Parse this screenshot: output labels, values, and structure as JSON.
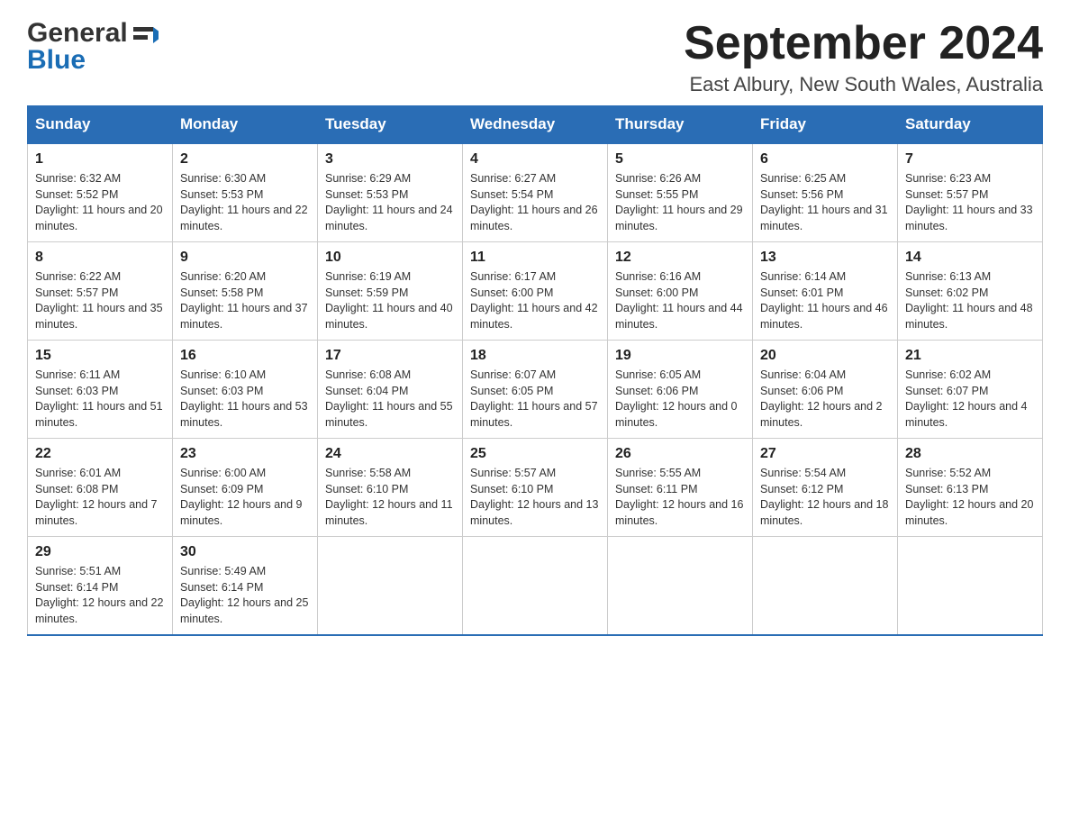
{
  "header": {
    "logo_general": "General",
    "logo_blue": "Blue",
    "month_title": "September 2024",
    "location": "East Albury, New South Wales, Australia"
  },
  "weekdays": [
    "Sunday",
    "Monday",
    "Tuesday",
    "Wednesday",
    "Thursday",
    "Friday",
    "Saturday"
  ],
  "weeks": [
    [
      {
        "day": "1",
        "sunrise": "6:32 AM",
        "sunset": "5:52 PM",
        "daylight": "11 hours and 20 minutes."
      },
      {
        "day": "2",
        "sunrise": "6:30 AM",
        "sunset": "5:53 PM",
        "daylight": "11 hours and 22 minutes."
      },
      {
        "day": "3",
        "sunrise": "6:29 AM",
        "sunset": "5:53 PM",
        "daylight": "11 hours and 24 minutes."
      },
      {
        "day": "4",
        "sunrise": "6:27 AM",
        "sunset": "5:54 PM",
        "daylight": "11 hours and 26 minutes."
      },
      {
        "day": "5",
        "sunrise": "6:26 AM",
        "sunset": "5:55 PM",
        "daylight": "11 hours and 29 minutes."
      },
      {
        "day": "6",
        "sunrise": "6:25 AM",
        "sunset": "5:56 PM",
        "daylight": "11 hours and 31 minutes."
      },
      {
        "day": "7",
        "sunrise": "6:23 AM",
        "sunset": "5:57 PM",
        "daylight": "11 hours and 33 minutes."
      }
    ],
    [
      {
        "day": "8",
        "sunrise": "6:22 AM",
        "sunset": "5:57 PM",
        "daylight": "11 hours and 35 minutes."
      },
      {
        "day": "9",
        "sunrise": "6:20 AM",
        "sunset": "5:58 PM",
        "daylight": "11 hours and 37 minutes."
      },
      {
        "day": "10",
        "sunrise": "6:19 AM",
        "sunset": "5:59 PM",
        "daylight": "11 hours and 40 minutes."
      },
      {
        "day": "11",
        "sunrise": "6:17 AM",
        "sunset": "6:00 PM",
        "daylight": "11 hours and 42 minutes."
      },
      {
        "day": "12",
        "sunrise": "6:16 AM",
        "sunset": "6:00 PM",
        "daylight": "11 hours and 44 minutes."
      },
      {
        "day": "13",
        "sunrise": "6:14 AM",
        "sunset": "6:01 PM",
        "daylight": "11 hours and 46 minutes."
      },
      {
        "day": "14",
        "sunrise": "6:13 AM",
        "sunset": "6:02 PM",
        "daylight": "11 hours and 48 minutes."
      }
    ],
    [
      {
        "day": "15",
        "sunrise": "6:11 AM",
        "sunset": "6:03 PM",
        "daylight": "11 hours and 51 minutes."
      },
      {
        "day": "16",
        "sunrise": "6:10 AM",
        "sunset": "6:03 PM",
        "daylight": "11 hours and 53 minutes."
      },
      {
        "day": "17",
        "sunrise": "6:08 AM",
        "sunset": "6:04 PM",
        "daylight": "11 hours and 55 minutes."
      },
      {
        "day": "18",
        "sunrise": "6:07 AM",
        "sunset": "6:05 PM",
        "daylight": "11 hours and 57 minutes."
      },
      {
        "day": "19",
        "sunrise": "6:05 AM",
        "sunset": "6:06 PM",
        "daylight": "12 hours and 0 minutes."
      },
      {
        "day": "20",
        "sunrise": "6:04 AM",
        "sunset": "6:06 PM",
        "daylight": "12 hours and 2 minutes."
      },
      {
        "day": "21",
        "sunrise": "6:02 AM",
        "sunset": "6:07 PM",
        "daylight": "12 hours and 4 minutes."
      }
    ],
    [
      {
        "day": "22",
        "sunrise": "6:01 AM",
        "sunset": "6:08 PM",
        "daylight": "12 hours and 7 minutes."
      },
      {
        "day": "23",
        "sunrise": "6:00 AM",
        "sunset": "6:09 PM",
        "daylight": "12 hours and 9 minutes."
      },
      {
        "day": "24",
        "sunrise": "5:58 AM",
        "sunset": "6:10 PM",
        "daylight": "12 hours and 11 minutes."
      },
      {
        "day": "25",
        "sunrise": "5:57 AM",
        "sunset": "6:10 PM",
        "daylight": "12 hours and 13 minutes."
      },
      {
        "day": "26",
        "sunrise": "5:55 AM",
        "sunset": "6:11 PM",
        "daylight": "12 hours and 16 minutes."
      },
      {
        "day": "27",
        "sunrise": "5:54 AM",
        "sunset": "6:12 PM",
        "daylight": "12 hours and 18 minutes."
      },
      {
        "day": "28",
        "sunrise": "5:52 AM",
        "sunset": "6:13 PM",
        "daylight": "12 hours and 20 minutes."
      }
    ],
    [
      {
        "day": "29",
        "sunrise": "5:51 AM",
        "sunset": "6:14 PM",
        "daylight": "12 hours and 22 minutes."
      },
      {
        "day": "30",
        "sunrise": "5:49 AM",
        "sunset": "6:14 PM",
        "daylight": "12 hours and 25 minutes."
      },
      null,
      null,
      null,
      null,
      null
    ]
  ],
  "labels": {
    "sunrise": "Sunrise:",
    "sunset": "Sunset:",
    "daylight": "Daylight:"
  }
}
